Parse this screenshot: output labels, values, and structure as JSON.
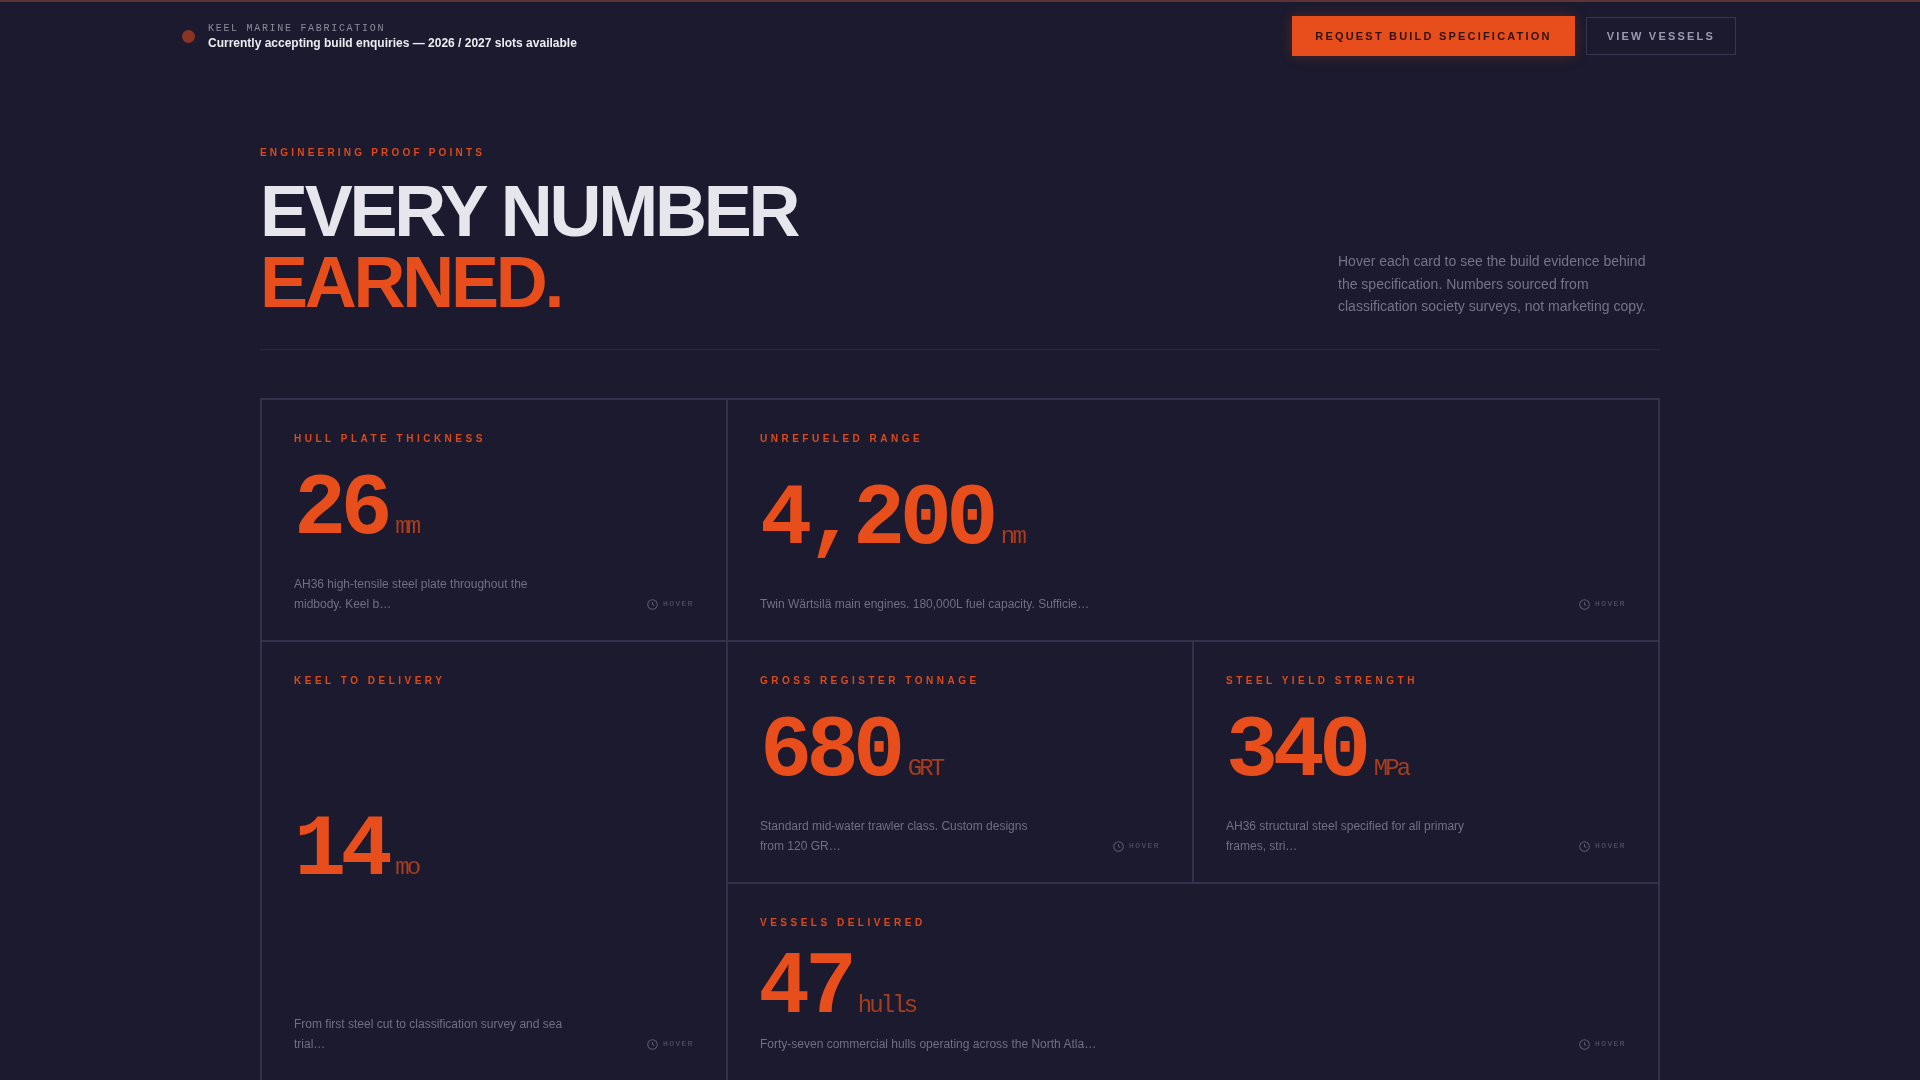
{
  "header": {
    "brand": "KEEL MARINE FABRICATION",
    "status": "Currently accepting build enquiries — 2026 / 2027 slots available",
    "actions": [
      {
        "label": "REQUEST BUILD SPECIFICATION",
        "kind": "primary"
      },
      {
        "label": "VIEW VESSELS",
        "kind": "secondary"
      }
    ]
  },
  "intro": {
    "eyebrow": "ENGINEERING PROOF POINTS",
    "title": "EVERY NUMBER",
    "title_accent": "EARNED.",
    "note": "Hover each card to see the build evidence behind the specification. Numbers sourced from classification society surveys, not marketing copy."
  },
  "cards": [
    {
      "label": "HULL PLATE THICKNESS",
      "value": "26",
      "unit": "mm",
      "description": "AH36 high-tensile steel plate throughout the midbody. Keel b…",
      "hint": "HOVER"
    },
    {
      "label": "UNREFUELED RANGE",
      "value": "4,200",
      "unit": "nm",
      "description": "Twin Wärtsilä main engines. 180,000L fuel capacity. Sufficie…",
      "hint": "HOVER"
    },
    {
      "label": "KEEL TO DELIVERY",
      "value": "14",
      "unit": "mo",
      "description": "From first steel cut to classification survey and sea trial…",
      "hint": "HOVER"
    },
    {
      "label": "GROSS REGISTER TONNAGE",
      "value": "680",
      "unit": "GRT",
      "description": "Standard mid-water trawler class. Custom designs from 120 GR…",
      "hint": "HOVER"
    },
    {
      "label": "STEEL YIELD STRENGTH",
      "value": "340",
      "unit": "MPa",
      "description": "AH36 structural steel specified for all primary frames, stri…",
      "hint": "HOVER"
    },
    {
      "label": "VESSELS DELIVERED",
      "value": "47",
      "unit": "hulls",
      "description": "Forty-seven commercial hulls operating across the North Atla…",
      "hint": "HOVER"
    }
  ]
}
